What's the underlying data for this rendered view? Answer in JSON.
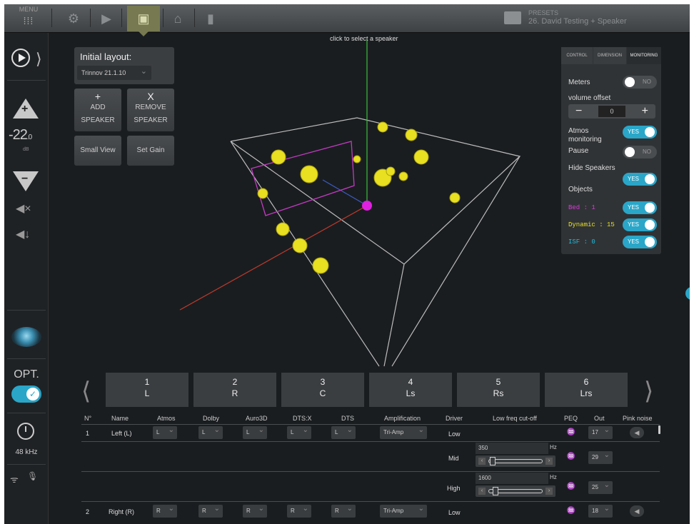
{
  "topbar": {
    "menu_label": "MENU",
    "presets_label": "PRESETS",
    "preset_name": "26. David Testing + Speaker"
  },
  "sidebar": {
    "volume": "-22",
    "volume_decimal": ".0",
    "volume_unit": "dB",
    "opt_label": "OPT.",
    "sample_rate": "48 kHz"
  },
  "layout_panel": {
    "title": "Initial layout:",
    "selected": "Trinnov 21.1.10",
    "add_symbol": "+",
    "add_line1": "ADD",
    "add_line2": "SPEAKER",
    "remove_symbol": "X",
    "remove_line1": "REMOVE",
    "remove_line2": "SPEAKER",
    "small_view": "Small View",
    "set_gain": "Set Gain"
  },
  "view": {
    "hint": "click to select a speaker"
  },
  "monitor_panel": {
    "tabs": [
      "CONTROL",
      "DIMENSION",
      "MONITORING"
    ],
    "active_tab": 2,
    "meters_label": "Meters",
    "meters_value": "NO",
    "volume_offset_label": "volume offset",
    "volume_offset_value": "0",
    "atmos_label_1": "Atmos",
    "atmos_label_2": "monitoring",
    "atmos_value": "YES",
    "pause_label": "Pause",
    "pause_value": "NO",
    "hide_label": "Hide Speakers",
    "hide_value": "YES",
    "objects_label": "Objects",
    "bed_label": "Bed : 1",
    "bed_value": "YES",
    "dynamic_label": "Dynamic : 15",
    "dynamic_value": "YES",
    "isf_label": "ISF : 0",
    "isf_value": "YES",
    "colors": {
      "bed": "#d63cd6",
      "dynamic": "#e8e020",
      "isf": "#22b8d8",
      "toggle_on": "#2aa6c8"
    }
  },
  "speakers": [
    {
      "num": "1",
      "code": "L"
    },
    {
      "num": "2",
      "code": "R"
    },
    {
      "num": "3",
      "code": "C"
    },
    {
      "num": "4",
      "code": "Ls"
    },
    {
      "num": "5",
      "code": "Rs"
    },
    {
      "num": "6",
      "code": "Lrs"
    }
  ],
  "table": {
    "headers": [
      "N°",
      "Name",
      "Atmos",
      "Dolby",
      "Auro3D",
      "DTS:X",
      "DTS",
      "Amplification",
      "Driver",
      "Low freq cut-off",
      "PEQ",
      "Out",
      "Pink noise"
    ],
    "row1": {
      "num": "1",
      "name": "Left (L)",
      "atmos": "L",
      "dolby": "L",
      "auro": "L",
      "dtsx": "L",
      "dts": "L",
      "amp": "Tri-Amp",
      "driver_low": "Low",
      "out_low": "17",
      "driver_mid": "Mid",
      "mid_freq": "350",
      "out_mid": "29",
      "driver_high": "High",
      "high_freq": "1600",
      "out_high": "25"
    },
    "row2": {
      "num": "2",
      "name": "Right (R)",
      "atmos": "R",
      "dolby": "R",
      "auro": "R",
      "dtsx": "R",
      "dts": "R",
      "amp": "Tri-Amp",
      "driver_low": "Low",
      "out_low": "18"
    },
    "hz": "Hz"
  }
}
